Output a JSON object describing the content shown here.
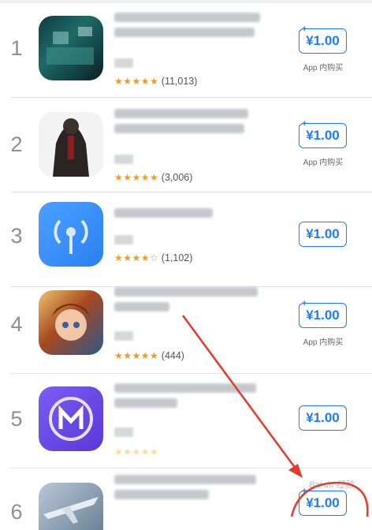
{
  "apps": [
    {
      "rank": "1",
      "rating_count": "(11,013)",
      "stars": "★★★★★",
      "price": "¥1.00",
      "has_plus": true,
      "iap": "App 内购买",
      "icon": "game-icon"
    },
    {
      "rank": "2",
      "rating_count": "(3,006)",
      "stars": "★★★★★",
      "price": "¥1.00",
      "has_plus": true,
      "iap": "App 内购买",
      "icon": "agent-figure-icon"
    },
    {
      "rank": "3",
      "rating_count": "(1,102)",
      "stars": "★★★★☆",
      "price": "¥1.00",
      "has_plus": false,
      "iap": "",
      "icon": "wifi-signal-icon"
    },
    {
      "rank": "4",
      "rating_count": "(444)",
      "stars": "★★★★★",
      "price": "¥1.00",
      "has_plus": true,
      "iap": "App 内购买",
      "icon": "anime-character-icon"
    },
    {
      "rank": "5",
      "rating_count": "",
      "stars": "★★★★★",
      "price": "¥1.00",
      "has_plus": false,
      "iap": "",
      "icon": "m-logo-icon"
    },
    {
      "rank": "6",
      "rating_count": "",
      "stars": "",
      "price": "¥1.00",
      "has_plus": true,
      "iap": "",
      "icon": "aircraft-icon"
    }
  ],
  "watermark": "Bai du 经验"
}
